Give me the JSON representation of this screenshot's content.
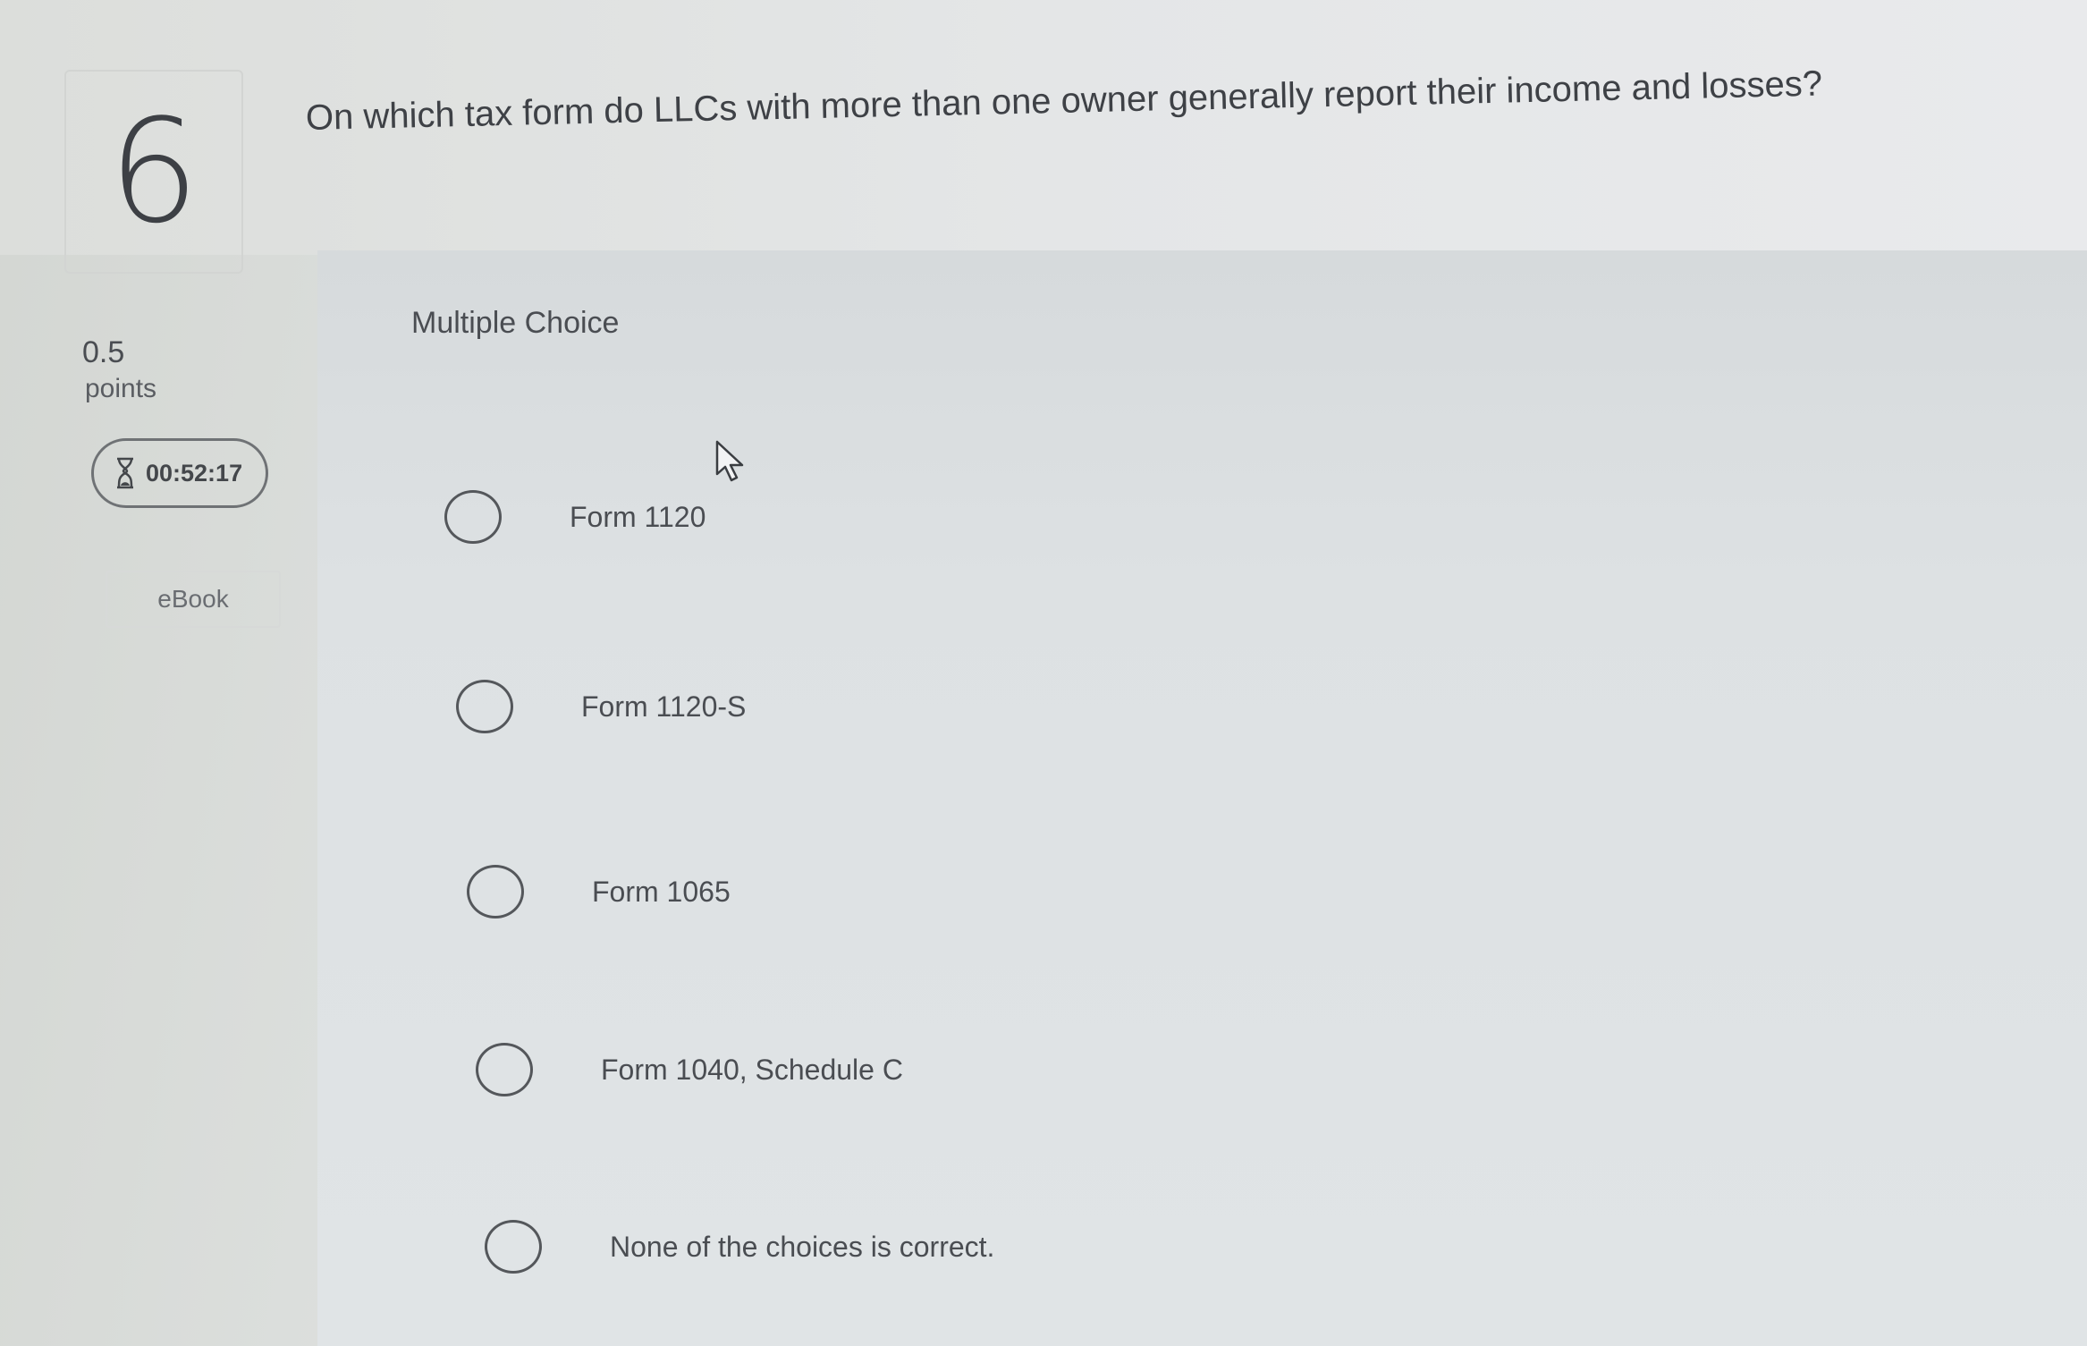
{
  "question": {
    "number": "6",
    "text": "On which tax form do LLCs with more than one owner generally report their income and losses?",
    "type_label": "Multiple Choice"
  },
  "sidebar": {
    "points_value": "0.5",
    "points_label": "points",
    "timer": "00:52:17",
    "timer_icon": "hourglass-icon",
    "ebook_label": "eBook"
  },
  "options": [
    {
      "label": "Form 1120",
      "selected": false
    },
    {
      "label": "Form 1120-S",
      "selected": false
    },
    {
      "label": "Form 1065",
      "selected": false
    },
    {
      "label": "Form 1040, Schedule C",
      "selected": false
    },
    {
      "label": "None of the choices is correct.",
      "selected": false
    }
  ],
  "colors": {
    "text": "#4a4d52",
    "radio_border": "#54575b",
    "timer_border": "#6f7275"
  }
}
